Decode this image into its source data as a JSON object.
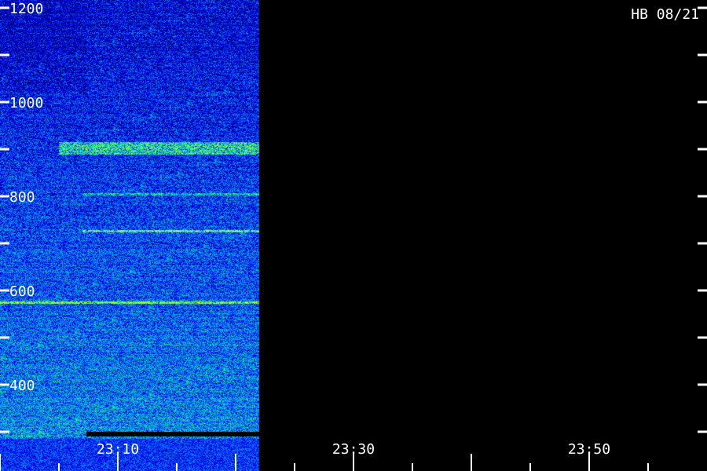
{
  "station_label": "HB 08/21",
  "chart_data": {
    "type": "heatmap",
    "title": "",
    "xlabel": "",
    "ylabel": "",
    "x_tick_labels": [
      "23:10",
      "23:30",
      "23:50"
    ],
    "y_tick_labels": [
      "1200",
      "1000",
      "800",
      "600",
      "400"
    ],
    "x_range_minutes": [
      "23:00",
      "23:59"
    ],
    "y_range": [
      380,
      1200
    ],
    "data_end_time": "23:22",
    "colormap": [
      "#000080",
      "#0000ff",
      "#0080ff",
      "#00c0c0",
      "#40ff80",
      "#c0ff00"
    ],
    "background_color": "#000000",
    "features": [
      {
        "kind": "band",
        "y_low": 890,
        "y_high": 915,
        "t_start": "23:05",
        "t_end": "23:22",
        "level": "high"
      },
      {
        "kind": "line",
        "y": 805,
        "t_start": "23:07",
        "t_end": "23:22",
        "level": "medium"
      },
      {
        "kind": "line",
        "y": 727,
        "t_start": "23:07",
        "t_end": "23:22",
        "level": "high"
      },
      {
        "kind": "line",
        "y": 575,
        "t_start": "23:00",
        "t_end": "23:22",
        "level": "high"
      }
    ]
  }
}
